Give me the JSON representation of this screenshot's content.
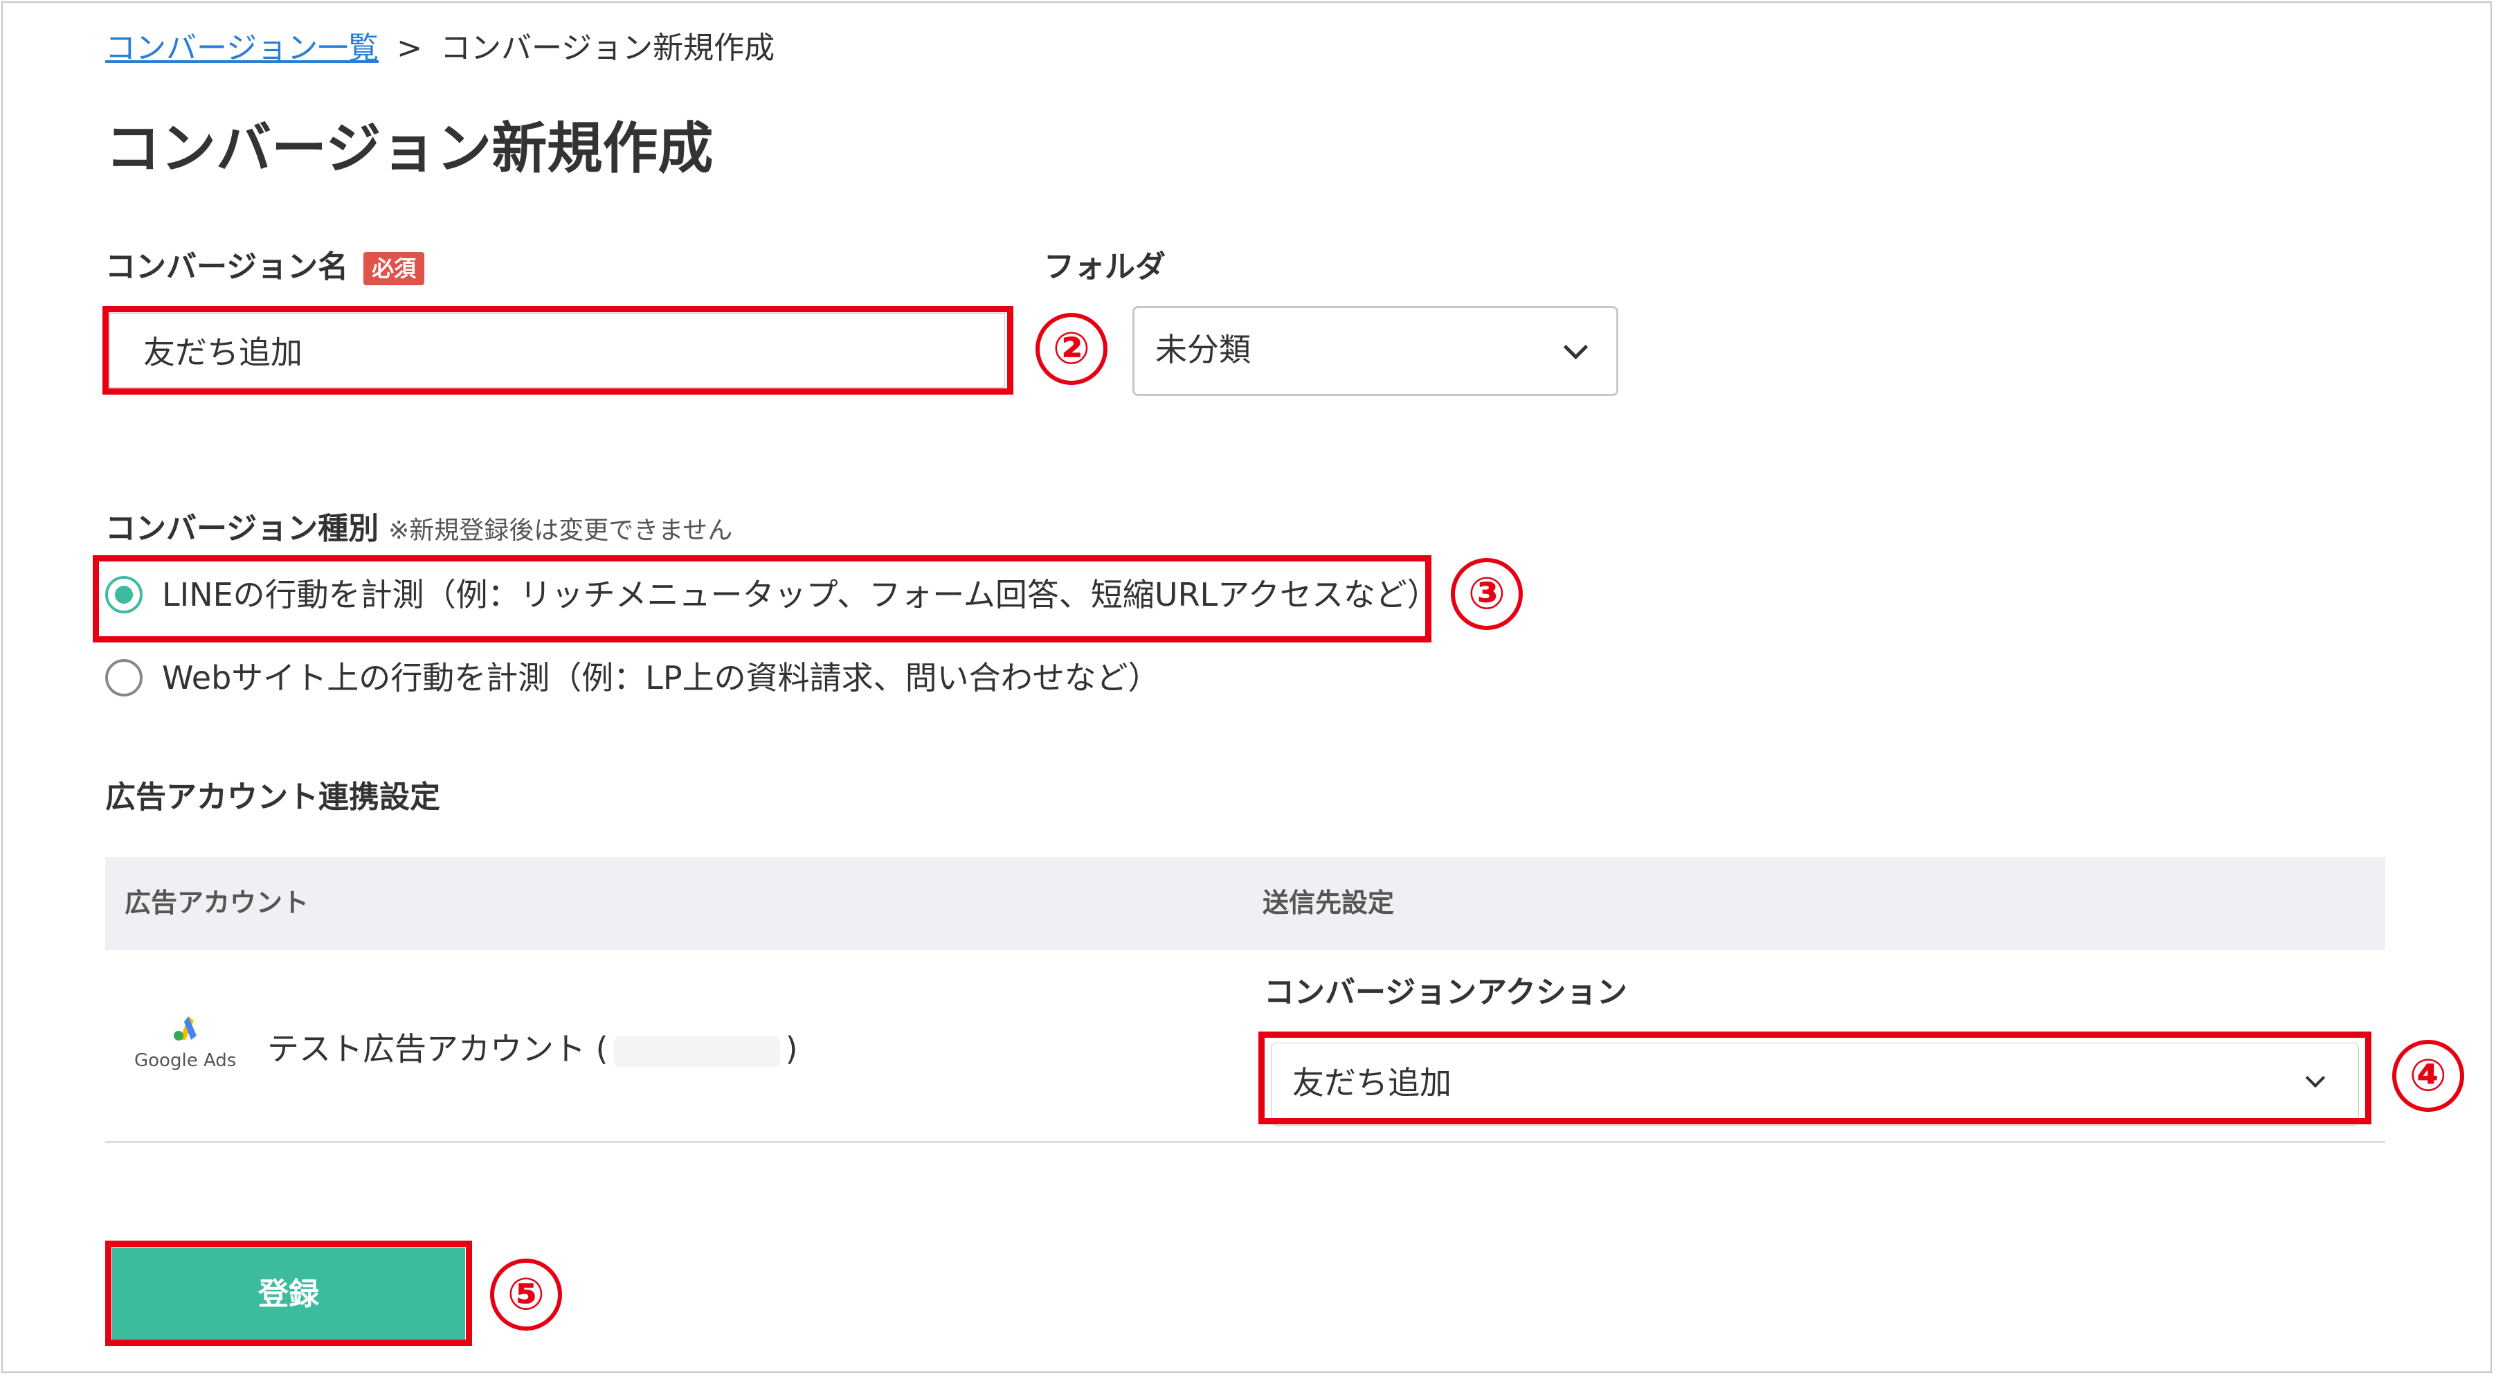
{
  "breadcrumb": {
    "link": "コンバージョン一覧",
    "separator": ">",
    "current": "コンバージョン新規作成"
  },
  "page_title": "コンバージョン新規作成",
  "form": {
    "name": {
      "label": "コンバージョン名",
      "required_badge": "必須",
      "value": "友だち追加"
    },
    "folder": {
      "label": "フォルダ",
      "selected": "未分類"
    },
    "type": {
      "label": "コンバージョン種別",
      "note": "※新規登録後は変更できません",
      "options": [
        {
          "label": "LINEの行動を計測（例：リッチメニュータップ、フォーム回答、短縮URLアクセスなど）",
          "checked": true
        },
        {
          "label": "Webサイト上の行動を計測（例：LP上の資料請求、問い合わせなど）",
          "checked": false
        }
      ]
    },
    "ad_account": {
      "section_title": "広告アカウント連携設定",
      "columns": [
        "広告アカウント",
        "送信先設定"
      ],
      "row": {
        "logo_text": "Google Ads",
        "account_name": "テスト広告アカウント (",
        "account_name_close": ")",
        "action_label": "コンバージョンアクション",
        "action_selected": "友だち追加"
      }
    },
    "submit_label": "登録"
  },
  "annotations": [
    "②",
    "③",
    "④",
    "⑤"
  ],
  "colors": {
    "accent": "#3dbb9f",
    "highlight": "#e60012",
    "badge": "#e0534a",
    "link": "#2a7fd4"
  }
}
